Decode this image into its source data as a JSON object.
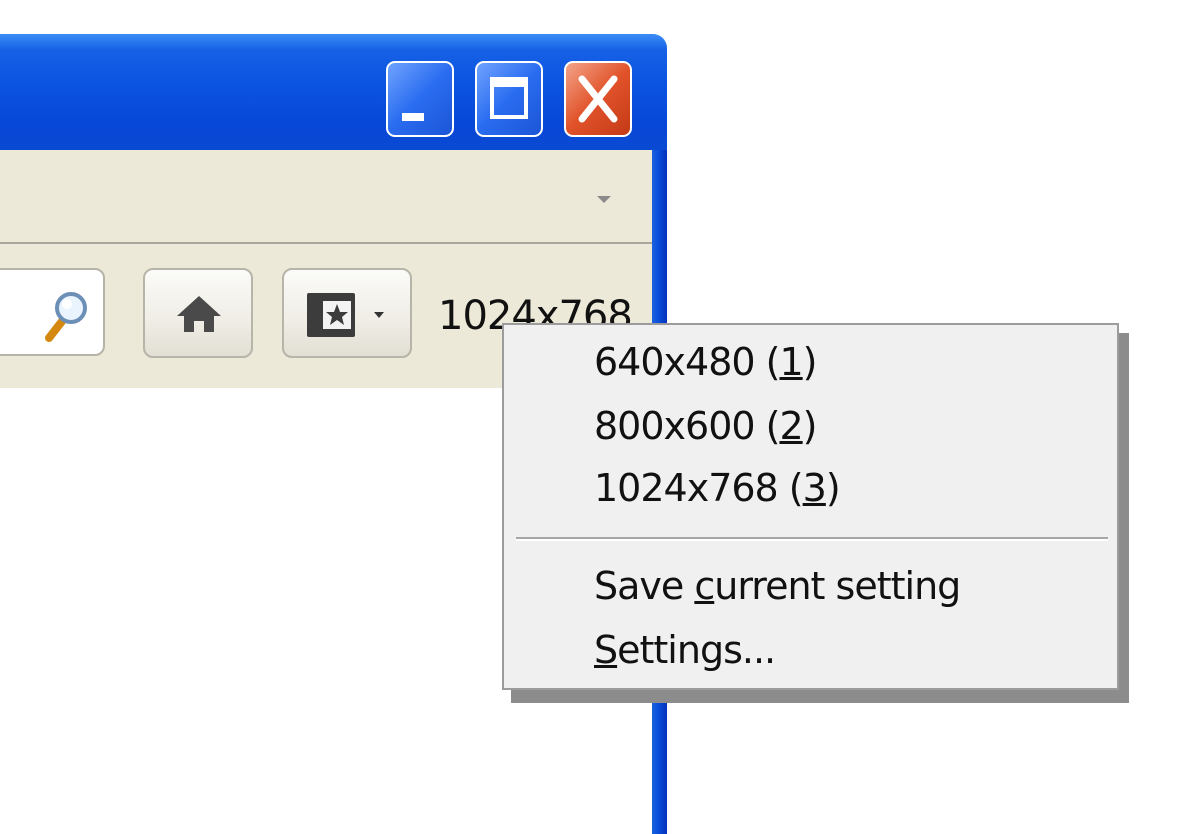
{
  "toolbar": {
    "resolution_label": "1024x768"
  },
  "resolution_menu": {
    "items": [
      {
        "before": "640x480 (",
        "key": "1",
        "after": ")"
      },
      {
        "before": "800x600 (",
        "key": "2",
        "after": ")"
      },
      {
        "before": "1024x768 (",
        "key": "3",
        "after": ")"
      }
    ],
    "actions": [
      {
        "before": "Save ",
        "key": "c",
        "after": "urrent setting"
      },
      {
        "before": "",
        "key": "S",
        "after": "ettings..."
      }
    ]
  }
}
